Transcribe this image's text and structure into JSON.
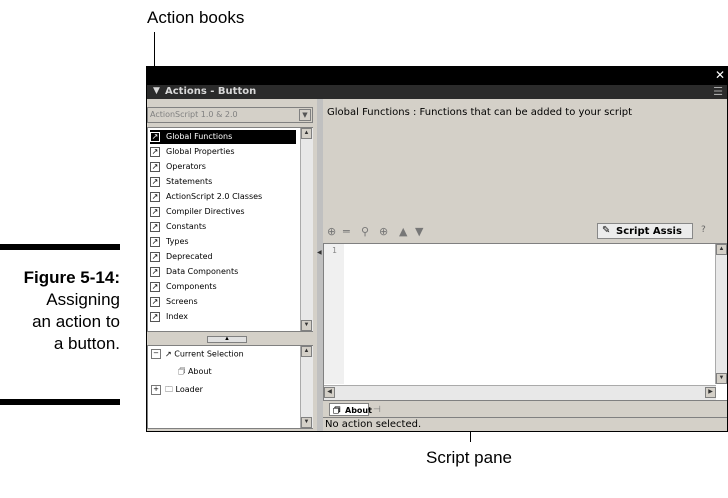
{
  "callouts": {
    "action_books": "Action books",
    "script_pane": "Script pane"
  },
  "caption": {
    "title": "Figure 5-14:",
    "line1": "Assigning",
    "line2": "an action to",
    "line3": "a button."
  },
  "window": {
    "close_glyph": "✕",
    "panel_arrow": "▼",
    "panel_title": "Actions - Button",
    "panel_menu": "☰",
    "version_label": "ActionScript 1.0 & 2.0",
    "books": [
      {
        "label": "Global Functions"
      },
      {
        "label": "Global Properties"
      },
      {
        "label": "Operators"
      },
      {
        "label": "Statements"
      },
      {
        "label": "ActionScript 2.0 Classes"
      },
      {
        "label": "Compiler Directives"
      },
      {
        "label": "Constants"
      },
      {
        "label": "Types"
      },
      {
        "label": "Deprecated"
      },
      {
        "label": "Data Components"
      },
      {
        "label": "Components"
      },
      {
        "label": "Screens"
      },
      {
        "label": "Index"
      }
    ],
    "navigator": {
      "current_selection": "Current Selection",
      "about": "About",
      "loader": "Loader"
    },
    "description": "Global Functions : Functions that can be added to your script",
    "script_assist_label": "Script Assis",
    "help_glyph": "?",
    "line_number": "1",
    "tab_label": "About",
    "status": "No action selected."
  }
}
